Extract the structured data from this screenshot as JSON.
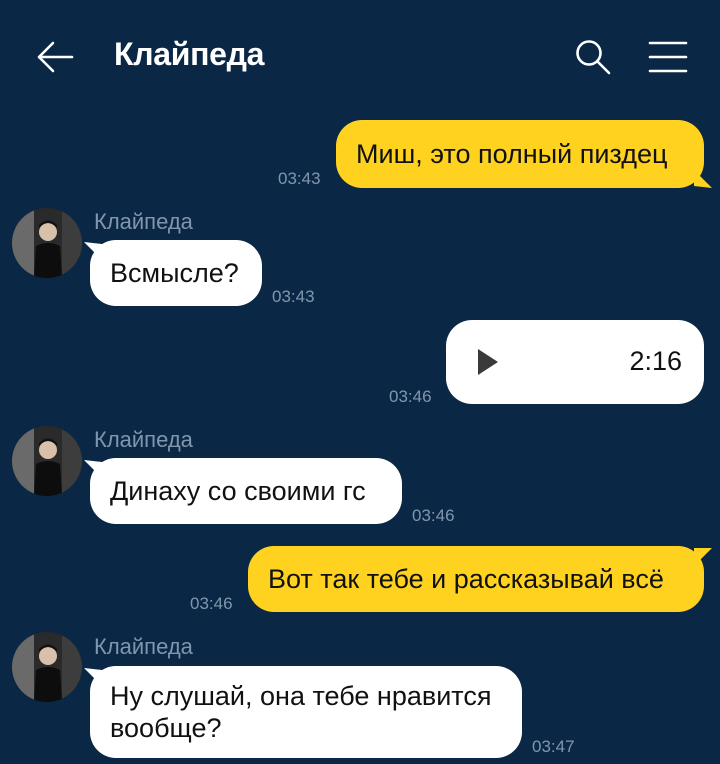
{
  "header": {
    "title": "Клайпеда",
    "back_icon": "arrow-left-icon",
    "search_icon": "search-icon",
    "menu_icon": "hamburger-menu-icon"
  },
  "colors": {
    "background": "#0a2846",
    "outgoing_bubble": "#ffd21f",
    "incoming_bubble": "#ffffff",
    "meta_text": "#8196ad"
  },
  "messages": [
    {
      "direction": "out",
      "text": "Миш, это полный пиздец",
      "time": "03:43"
    },
    {
      "direction": "in",
      "sender": "Клайпеда",
      "text": "Всмысле?",
      "time": "03:43"
    },
    {
      "direction": "out",
      "type": "voice",
      "duration": "2:16",
      "time": "03:46",
      "play_icon": "play-icon"
    },
    {
      "direction": "in",
      "sender": "Клайпеда",
      "text": "Динаху со своими гс",
      "time": "03:46"
    },
    {
      "direction": "out",
      "text": "Вот так тебе и рассказывай всё",
      "time": "03:46"
    },
    {
      "direction": "in",
      "sender": "Клайпеда",
      "text": "Ну слушай, она тебе нравится вообще?",
      "time": "03:47"
    }
  ]
}
